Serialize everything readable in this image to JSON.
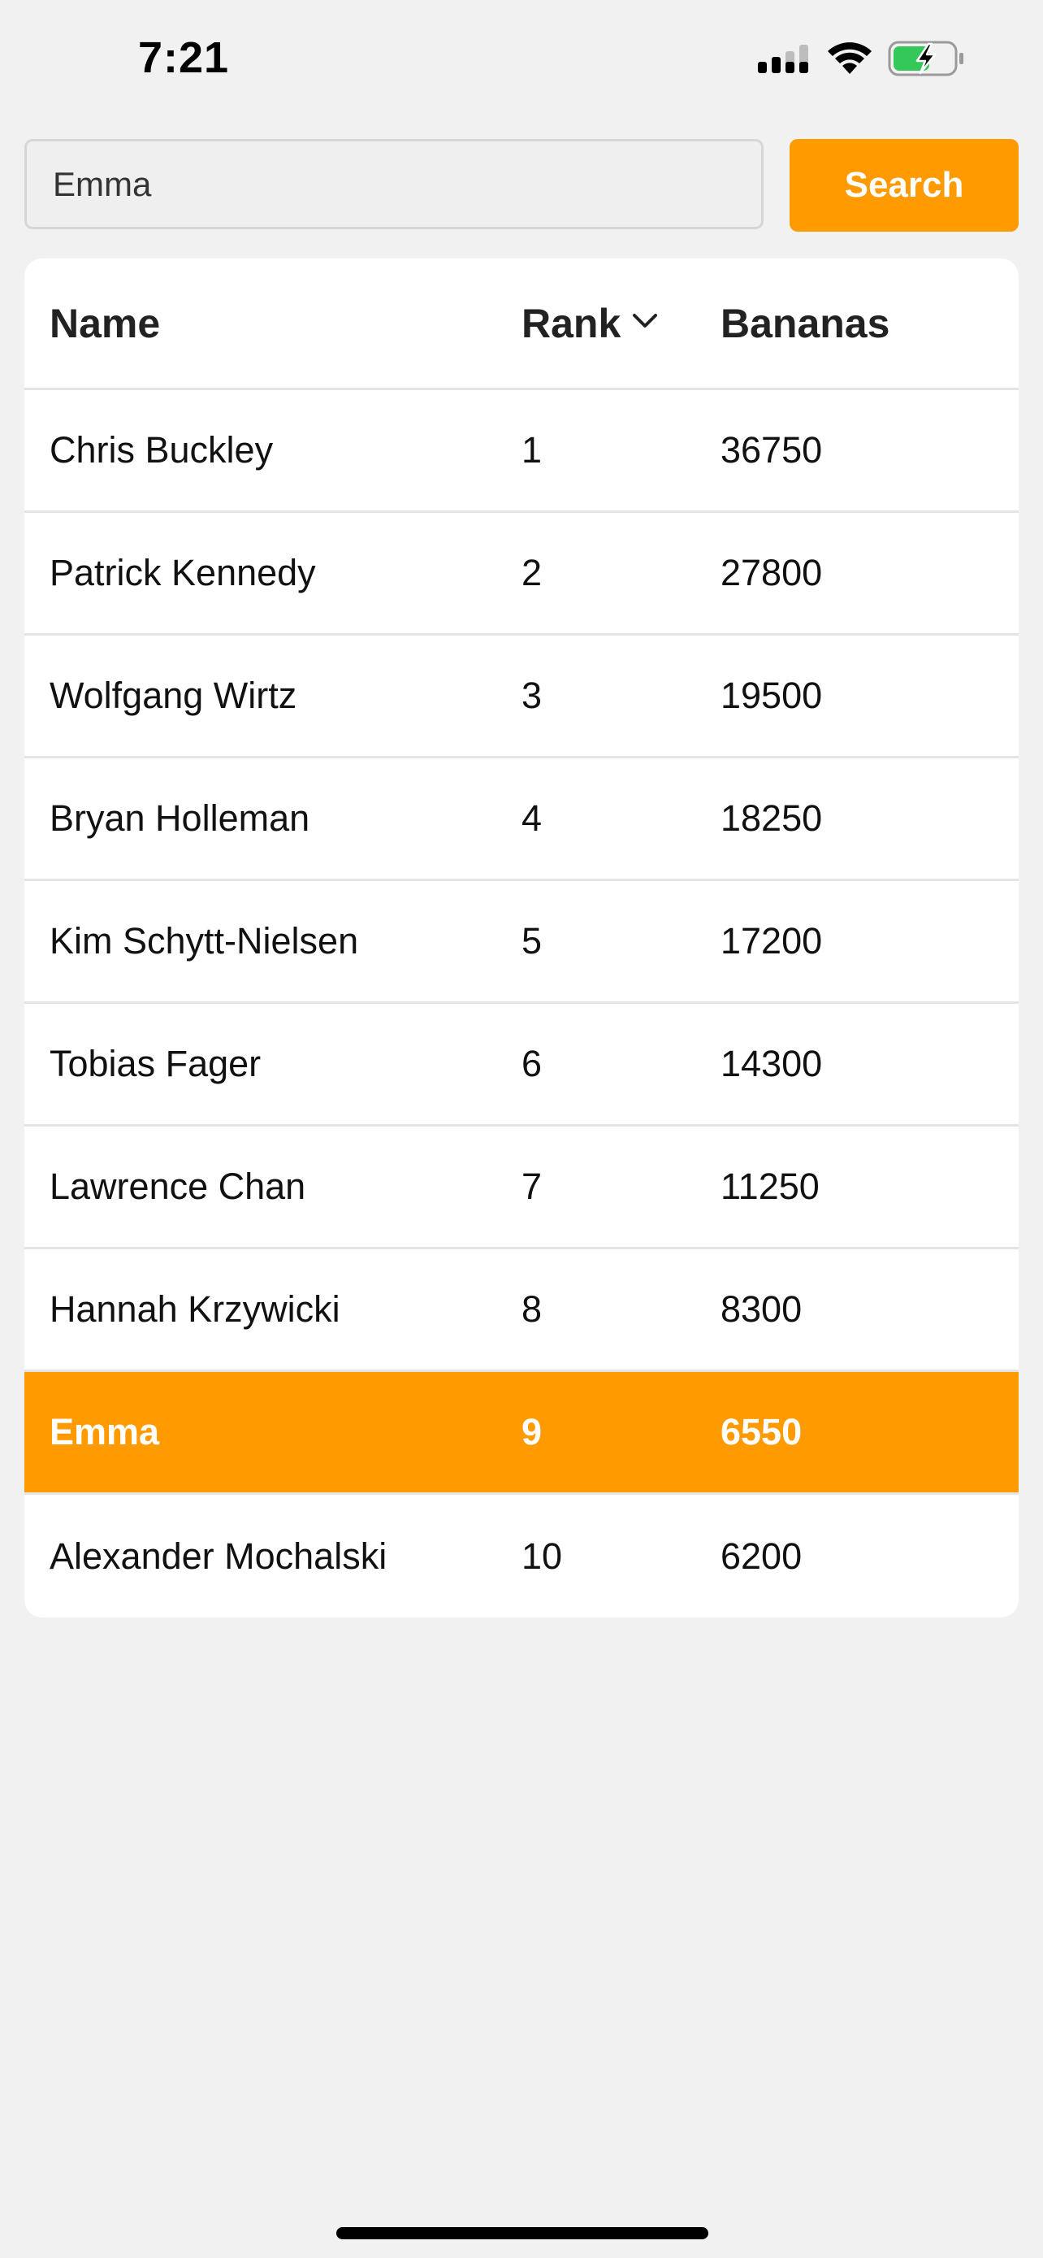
{
  "status_bar": {
    "time": "7:21"
  },
  "search": {
    "value": "Emma",
    "button_label": "Search"
  },
  "table": {
    "columns": {
      "name": "Name",
      "rank": "Rank",
      "bananas": "Bananas"
    },
    "rows": [
      {
        "name": "Chris Buckley",
        "rank": "1",
        "bananas": "36750"
      },
      {
        "name": "Patrick Kennedy",
        "rank": "2",
        "bananas": "27800"
      },
      {
        "name": "Wolfgang Wirtz",
        "rank": "3",
        "bananas": "19500"
      },
      {
        "name": "Bryan Holleman",
        "rank": "4",
        "bananas": "18250"
      },
      {
        "name": "Kim Schytt-Nielsen",
        "rank": "5",
        "bananas": "17200"
      },
      {
        "name": "Tobias Fager",
        "rank": "6",
        "bananas": "14300"
      },
      {
        "name": "Lawrence Chan",
        "rank": "7",
        "bananas": "11250"
      },
      {
        "name": "Hannah Krzywicki",
        "rank": "8",
        "bananas": "8300"
      },
      {
        "name": "Emma",
        "rank": "9",
        "bananas": "6550"
      },
      {
        "name": "Alexander Mochalski",
        "rank": "10",
        "bananas": "6200"
      }
    ],
    "highlighted_row": 8,
    "sort_indicator_icon": "chevron-down-icon"
  },
  "colors": {
    "accent": "#ff9a00",
    "background": "#f1f1f1",
    "card": "#ffffff",
    "battery_charge": "#34c759"
  },
  "icons": [
    "signal-icon",
    "wifi-icon",
    "battery-charging-icon",
    "chevron-down-icon"
  ]
}
